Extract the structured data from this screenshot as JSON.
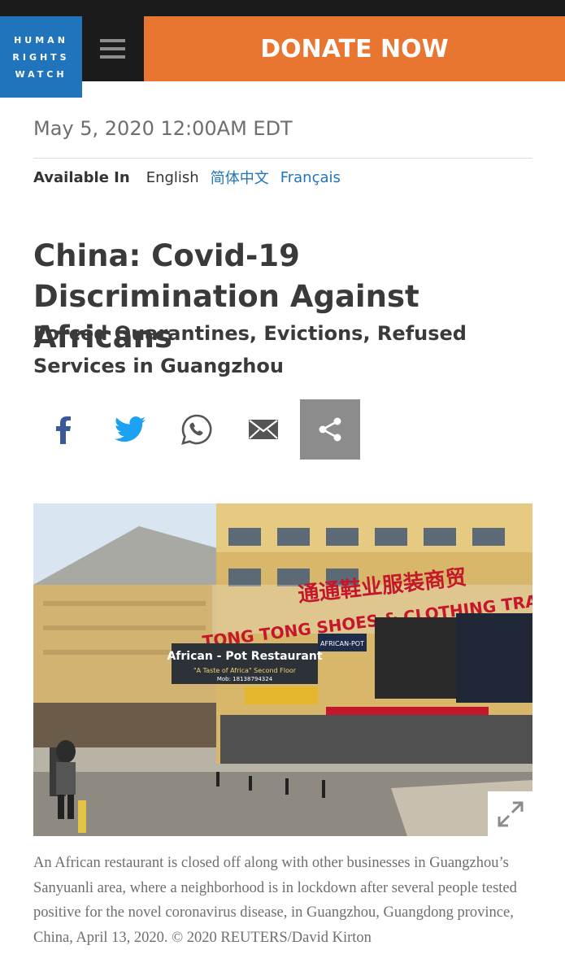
{
  "brand": {
    "logo_lines": [
      "HUMAN",
      "RIGHTS",
      "WATCH"
    ]
  },
  "header": {
    "donate_label": "DONATE NOW",
    "menu_icon": "hamburger-icon"
  },
  "article": {
    "date": "May 5, 2020 12:00AM EDT",
    "available_in_label": "Available In",
    "languages": {
      "current": "English",
      "links": [
        "简体中文",
        "Français"
      ]
    },
    "title": "China: Covid-19 Discrimination Against Africans",
    "subtitle": "Forced Quarantines, Evictions, Refused Services in Guangzhou",
    "share_icons": [
      "facebook-icon",
      "twitter-icon",
      "whatsapp-icon",
      "email-icon",
      "share-icon"
    ],
    "photo": {
      "signs": [
        "TONG TONG SHOES & CLOTHING TRADE",
        "African - Pot Restaurant",
        "\"A Taste of Africa\" Second Floor",
        "AFRICAN-POT",
        "Mob: 18138794324"
      ],
      "caption": "An African restaurant is closed off along with other businesses in Guangzhou’s Sanyuanli area, where a neighborhood is in lockdown after several people tested positive for the novel coronavirus disease, in Guangzhou, Guangdong province, China, April 13, 2020.  © 2020 REUTERS/David Kirton"
    }
  },
  "colors": {
    "brand_blue": "#1f74bb",
    "donate_orange": "#e87530",
    "header_dark": "#1b1b1b",
    "facebook": "#3b5998",
    "twitter": "#1da1f2"
  }
}
